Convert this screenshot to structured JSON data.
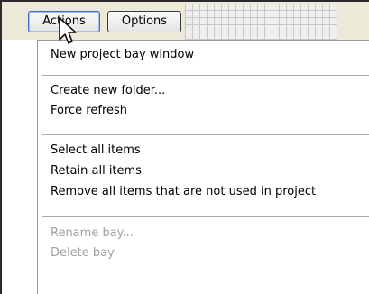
{
  "toolbar": {
    "actions_label": "Actions",
    "options_label": "Options"
  },
  "menu": {
    "group1": [
      "New project bay window"
    ],
    "group2": [
      "Create new folder...",
      "Force refresh"
    ],
    "group3": [
      "Select all items",
      "Retain all items",
      "Remove all items that are not used in project"
    ],
    "group4": [
      "Rename bay...",
      "Delete bay"
    ]
  },
  "icons": {
    "cursor": "arrow-cursor-icon"
  },
  "colors": {
    "button_border_active": "#3b6bc4",
    "menu_disabled_text": "#a0a0a0",
    "toolbar_bg": "#ece9d8"
  }
}
